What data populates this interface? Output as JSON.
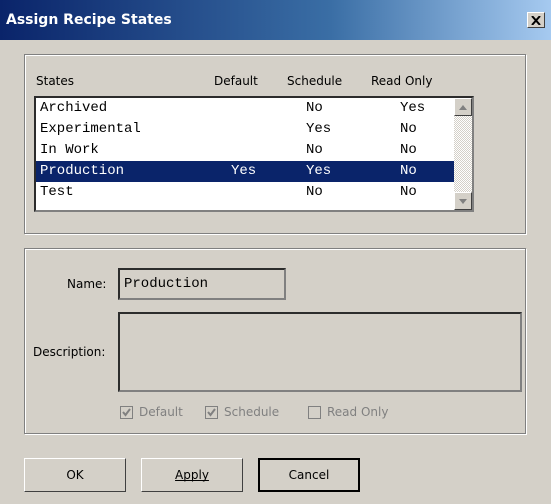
{
  "window": {
    "title": "Assign Recipe States",
    "close_symbol": "close-icon"
  },
  "states_table": {
    "headers": {
      "states": "States",
      "default": "Default",
      "schedule": "Schedule",
      "read_only": "Read Only"
    },
    "rows": [
      {
        "name": "Archived",
        "default": "",
        "schedule": "No",
        "read_only": "Yes",
        "selected": false
      },
      {
        "name": "Experimental",
        "default": "",
        "schedule": "Yes",
        "read_only": "No",
        "selected": false
      },
      {
        "name": "In Work",
        "default": "",
        "schedule": "No",
        "read_only": "No",
        "selected": false
      },
      {
        "name": "Production",
        "default": "Yes",
        "schedule": "Yes",
        "read_only": "No",
        "selected": true
      },
      {
        "name": "Test",
        "default": "",
        "schedule": "No",
        "read_only": "No",
        "selected": false
      }
    ]
  },
  "details": {
    "name_label": "Name:",
    "name_value": "Production",
    "description_label": "Description:",
    "description_value": "",
    "checkboxes": [
      {
        "label": "Default",
        "checked": true,
        "enabled": false
      },
      {
        "label": "Schedule",
        "checked": true,
        "enabled": false
      },
      {
        "label": "Read Only",
        "checked": false,
        "enabled": false
      }
    ]
  },
  "buttons": {
    "ok": "OK",
    "apply": "Apply",
    "cancel": "Cancel"
  },
  "colors": {
    "dialog_bg": "#d4d0c8",
    "selection_bg": "#0a246a",
    "titlebar_start": "#0a246a",
    "titlebar_end": "#a6caf0"
  }
}
